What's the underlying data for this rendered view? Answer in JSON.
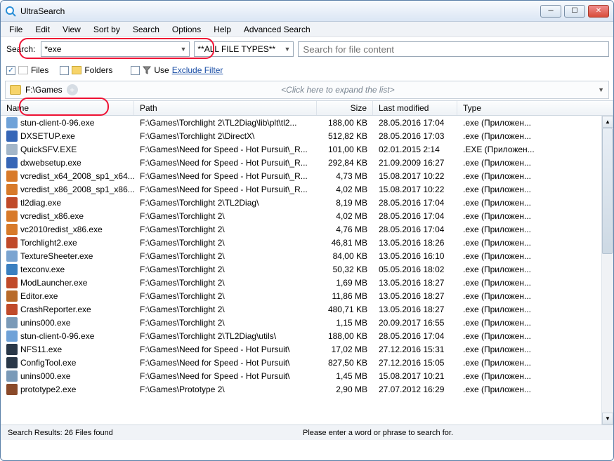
{
  "app": {
    "title": "UltraSearch"
  },
  "menu": [
    "File",
    "Edit",
    "View",
    "Sort by",
    "Search",
    "Options",
    "Help",
    "Advanced Search"
  ],
  "search": {
    "label": "Search:",
    "query": "*exe",
    "filetype": "**ALL FILE TYPES**",
    "content_placeholder": "Search for file content"
  },
  "filters": {
    "files_label": "Files",
    "folders_label": "Folders",
    "use_label": "Use",
    "exclude_label": "Exclude Filter"
  },
  "path": {
    "value": "F:\\Games",
    "expand_hint": "<Click here to expand the list>"
  },
  "columns": {
    "name": "Name",
    "path": "Path",
    "size": "Size",
    "date": "Last modified",
    "type": "Type"
  },
  "rows": [
    {
      "icon": "#6fa2d8",
      "name": "stun-client-0-96.exe",
      "path": "F:\\Games\\Torchlight 2\\TL2Diag\\lib\\plt\\tl2...",
      "size": "188,00 KB",
      "date": "28.05.2016 17:04",
      "type": ".exe (Приложен..."
    },
    {
      "icon": "#3666b7",
      "name": "DXSETUP.exe",
      "path": "F:\\Games\\Torchlight 2\\DirectX\\",
      "size": "512,82 KB",
      "date": "28.05.2016 17:03",
      "type": ".exe (Приложен..."
    },
    {
      "icon": "#a3b6c9",
      "name": "QuickSFV.EXE",
      "path": "F:\\Games\\Need for Speed - Hot Pursuit\\_R...",
      "size": "101,00 KB",
      "date": "02.01.2015 2:14",
      "type": ".EXE (Приложен..."
    },
    {
      "icon": "#3666b7",
      "name": "dxwebsetup.exe",
      "path": "F:\\Games\\Need for Speed - Hot Pursuit\\_R...",
      "size": "292,84 KB",
      "date": "21.09.2009 16:27",
      "type": ".exe (Приложен..."
    },
    {
      "icon": "#d87a2a",
      "name": "vcredist_x64_2008_sp1_x64....",
      "path": "F:\\Games\\Need for Speed - Hot Pursuit\\_R...",
      "size": "4,73 MB",
      "date": "15.08.2017 10:22",
      "type": ".exe (Приложен..."
    },
    {
      "icon": "#d87a2a",
      "name": "vcredist_x86_2008_sp1_x86....",
      "path": "F:\\Games\\Need for Speed - Hot Pursuit\\_R...",
      "size": "4,02 MB",
      "date": "15.08.2017 10:22",
      "type": ".exe (Приложен..."
    },
    {
      "icon": "#c04a2a",
      "name": "tl2diag.exe",
      "path": "F:\\Games\\Torchlight 2\\TL2Diag\\",
      "size": "8,19 MB",
      "date": "28.05.2016 17:04",
      "type": ".exe (Приложен..."
    },
    {
      "icon": "#d87a2a",
      "name": "vcredist_x86.exe",
      "path": "F:\\Games\\Torchlight 2\\",
      "size": "4,02 MB",
      "date": "28.05.2016 17:04",
      "type": ".exe (Приложен..."
    },
    {
      "icon": "#d87a2a",
      "name": "vc2010redist_x86.exe",
      "path": "F:\\Games\\Torchlight 2\\",
      "size": "4,76 MB",
      "date": "28.05.2016 17:04",
      "type": ".exe (Приложен..."
    },
    {
      "icon": "#c04a2a",
      "name": "Torchlight2.exe",
      "path": "F:\\Games\\Torchlight 2\\",
      "size": "46,81 MB",
      "date": "13.05.2016 18:26",
      "type": ".exe (Приложен..."
    },
    {
      "icon": "#7aa4d1",
      "name": "TextureSheeter.exe",
      "path": "F:\\Games\\Torchlight 2\\",
      "size": "84,00 KB",
      "date": "13.05.2016 16:10",
      "type": ".exe (Приложен..."
    },
    {
      "icon": "#3a7fc0",
      "name": "texconv.exe",
      "path": "F:\\Games\\Torchlight 2\\",
      "size": "50,32 KB",
      "date": "05.05.2016 18:02",
      "type": ".exe (Приложен..."
    },
    {
      "icon": "#c04a2a",
      "name": "ModLauncher.exe",
      "path": "F:\\Games\\Torchlight 2\\",
      "size": "1,69 MB",
      "date": "13.05.2016 18:27",
      "type": ".exe (Приложен..."
    },
    {
      "icon": "#b86a2a",
      "name": "Editor.exe",
      "path": "F:\\Games\\Torchlight 2\\",
      "size": "11,86 MB",
      "date": "13.05.2016 18:27",
      "type": ".exe (Приложен..."
    },
    {
      "icon": "#c04a2a",
      "name": "CrashReporter.exe",
      "path": "F:\\Games\\Torchlight 2\\",
      "size": "480,71 KB",
      "date": "13.05.2016 18:27",
      "type": ".exe (Приложен..."
    },
    {
      "icon": "#7a9ab8",
      "name": "unins000.exe",
      "path": "F:\\Games\\Torchlight 2\\",
      "size": "1,15 MB",
      "date": "20.09.2017 16:55",
      "type": ".exe (Приложен..."
    },
    {
      "icon": "#6fa2d8",
      "name": "stun-client-0-96.exe",
      "path": "F:\\Games\\Torchlight 2\\TL2Diag\\utils\\",
      "size": "188,00 KB",
      "date": "28.05.2016 17:04",
      "type": ".exe (Приложен..."
    },
    {
      "icon": "#2a3848",
      "name": "NFS11.exe",
      "path": "F:\\Games\\Need for Speed - Hot Pursuit\\",
      "size": "17,02 MB",
      "date": "27.12.2016 15:31",
      "type": ".exe (Приложен..."
    },
    {
      "icon": "#2a3848",
      "name": "ConfigTool.exe",
      "path": "F:\\Games\\Need for Speed - Hot Pursuit\\",
      "size": "827,50 KB",
      "date": "27.12.2016 15:05",
      "type": ".exe (Приложен..."
    },
    {
      "icon": "#7a9ab8",
      "name": "unins000.exe",
      "path": "F:\\Games\\Need for Speed - Hot Pursuit\\",
      "size": "1,45 MB",
      "date": "15.08.2017 10:21",
      "type": ".exe (Приложен..."
    },
    {
      "icon": "#8a4a2a",
      "name": "prototype2.exe",
      "path": "F:\\Games\\Prototype 2\\",
      "size": "2,90 MB",
      "date": "27.07.2012 16:29",
      "type": ".exe (Приложен..."
    }
  ],
  "status": {
    "results": "Search Results:   26 Files found",
    "hint": "Please enter a word or phrase to search for."
  }
}
